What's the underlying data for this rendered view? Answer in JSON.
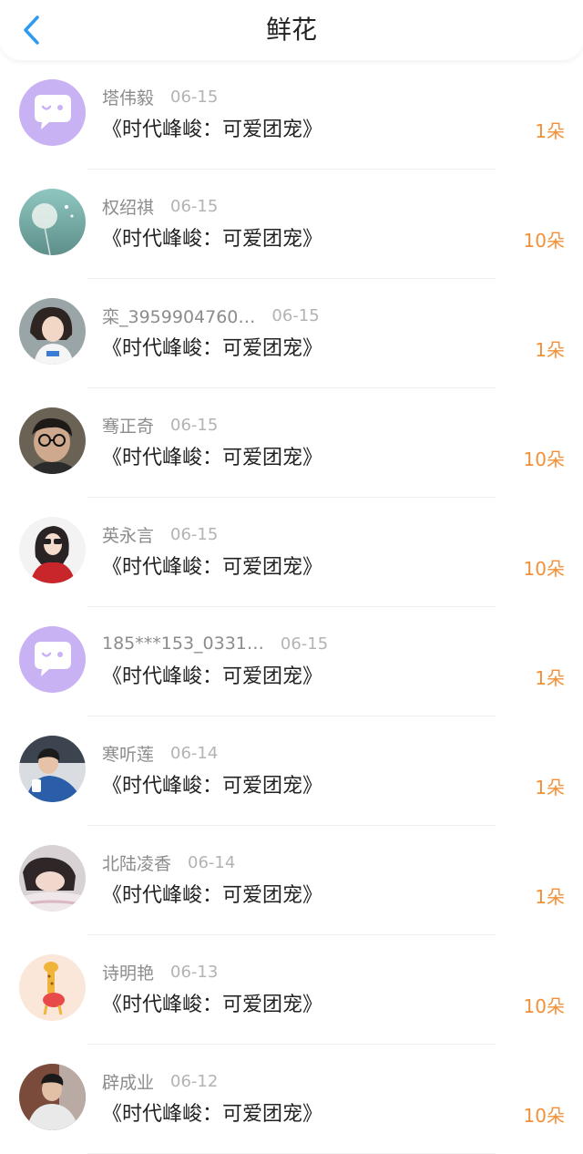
{
  "header": {
    "title": "鲜花"
  },
  "colors": {
    "accent": "#2f9bf0",
    "count": "#f0913a",
    "default_avatar": "#c9b2f3"
  },
  "rows": [
    {
      "name": "塔伟毅",
      "date": "06-15",
      "book": "《时代峰峻：可爱团宠》",
      "count": "1朵",
      "avatar": "default-chat-icon"
    },
    {
      "name": "权绍祺",
      "date": "06-15",
      "book": "《时代峰峻：可爱团宠》",
      "count": "10朵",
      "avatar": "dandelion-photo"
    },
    {
      "name": "栾_3959904760…",
      "date": "06-15",
      "book": "《时代峰峻：可爱团宠》",
      "count": "1朵",
      "avatar": "girl-photo"
    },
    {
      "name": "骞正奇",
      "date": "06-15",
      "book": "《时代峰峻：可爱团宠》",
      "count": "10朵",
      "avatar": "glasses-photo"
    },
    {
      "name": "英永言",
      "date": "06-15",
      "book": "《时代峰峻：可爱团宠》",
      "count": "10朵",
      "avatar": "woman-photo"
    },
    {
      "name": "185***153_0331…",
      "date": "06-15",
      "book": "《时代峰峻：可爱团宠》",
      "count": "1朵",
      "avatar": "default-chat-icon"
    },
    {
      "name": "寒听莲",
      "date": "06-14",
      "book": "《时代峰峻：可爱团宠》",
      "count": "1朵",
      "avatar": "man-photo"
    },
    {
      "name": "北陆凌香",
      "date": "06-14",
      "book": "《时代峰峻：可爱团宠》",
      "count": "1朵",
      "avatar": "sleeping-girl-photo"
    },
    {
      "name": "诗明艳",
      "date": "06-13",
      "book": "《时代峰峻：可爱团宠》",
      "count": "10朵",
      "avatar": "giraffe-photo"
    },
    {
      "name": "辟成业",
      "date": "06-12",
      "book": "《时代峰峻：可爱团宠》",
      "count": "10朵",
      "avatar": "man-dark-photo"
    }
  ]
}
